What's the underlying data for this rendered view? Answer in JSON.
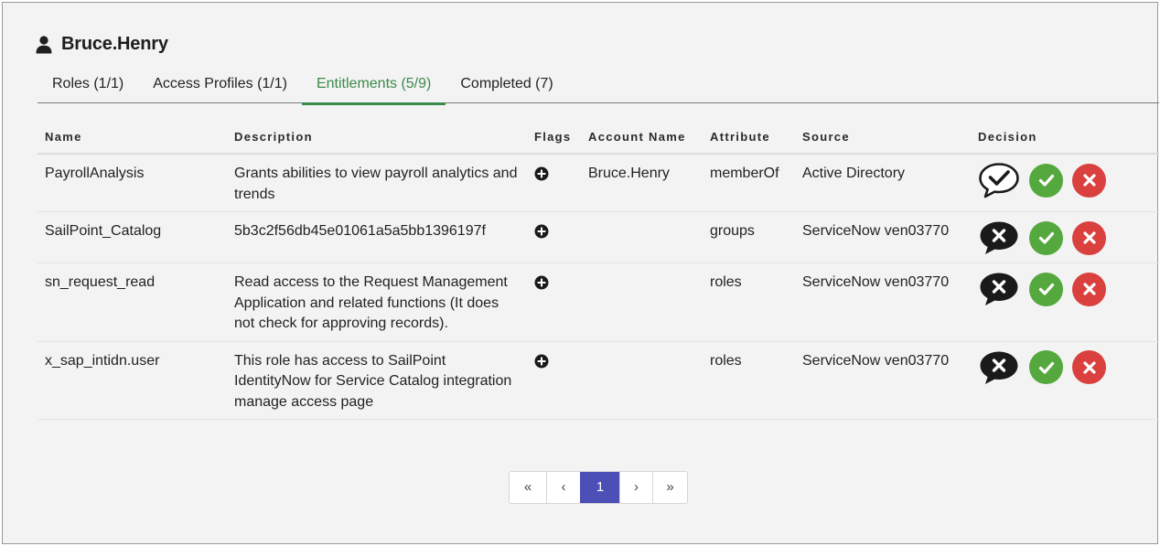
{
  "user": {
    "name": "Bruce.Henry",
    "icon": "user-icon"
  },
  "tabs": [
    {
      "label": "Roles (1/1)"
    },
    {
      "label": "Access Profiles (1/1)"
    },
    {
      "label": "Entitlements (5/9)",
      "active": true
    },
    {
      "label": "Completed (7)"
    }
  ],
  "table": {
    "headers": {
      "name": "Name",
      "description": "Description",
      "flags": "Flags",
      "account_name": "Account Name",
      "attribute": "Attribute",
      "source": "Source",
      "decision": "Decision"
    },
    "rows": [
      {
        "name": "PayrollAnalysis",
        "description": "Grants abilities to view payroll analytics and trends",
        "flag_icon": "plus-circle-icon",
        "account_name": "Bruce.Henry",
        "attribute": "memberOf",
        "source": "Active Directory",
        "comment_icon": "comment-check-outline-icon"
      },
      {
        "name": "SailPoint_Catalog",
        "description": "5b3c2f56db45e01061a5a5bb1396197f",
        "flag_icon": "plus-circle-icon",
        "account_name": "",
        "attribute": "groups",
        "source": "ServiceNow ven03770",
        "comment_icon": "comment-x-filled-icon"
      },
      {
        "name": "sn_request_read",
        "description": "Read access to the Request Management Application and related functions (It does not check for approving records).",
        "flag_icon": "plus-circle-icon",
        "account_name": "",
        "attribute": "roles",
        "source": "ServiceNow ven03770",
        "comment_icon": "comment-x-filled-icon"
      },
      {
        "name": "x_sap_intidn.user",
        "description": "This role has access to SailPoint IdentityNow for Service Catalog integration manage access page",
        "flag_icon": "plus-circle-icon",
        "account_name": "",
        "attribute": "roles",
        "source": "ServiceNow ven03770",
        "comment_icon": "comment-x-filled-icon"
      }
    ]
  },
  "pagination": {
    "first": "«",
    "prev": "‹",
    "current": "1",
    "next": "›",
    "last": "»"
  },
  "colors": {
    "active_tab": "#3a8a4a",
    "approve": "#55a83e",
    "reject": "#d9403e",
    "page_current": "#4b4fb6"
  }
}
